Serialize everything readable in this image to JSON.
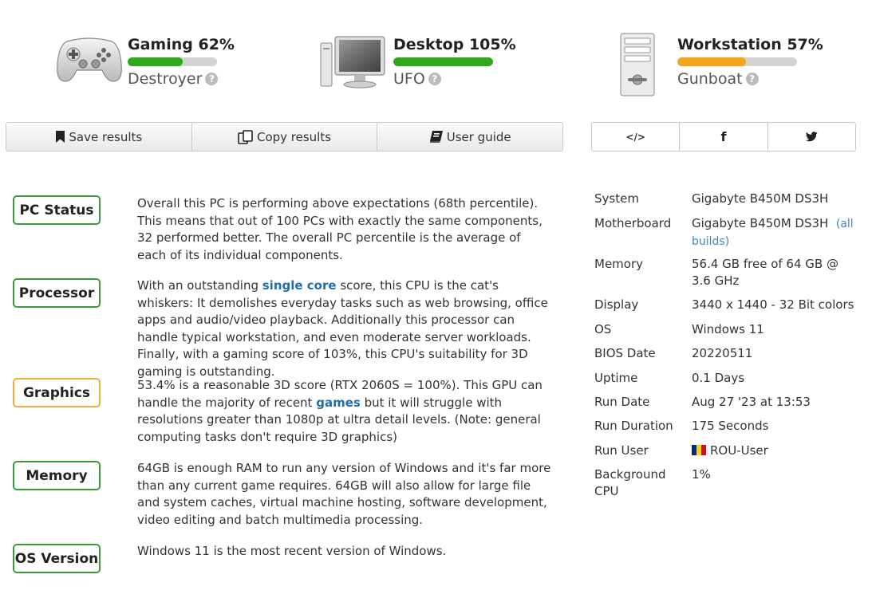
{
  "scores": [
    {
      "title": "Gaming 62%",
      "sub": "Destroyer",
      "percent": 62,
      "color": "#2fa81a",
      "icon": "gamepad-icon"
    },
    {
      "title": "Desktop 105%",
      "sub": "UFO",
      "percent": 100,
      "color": "#2fa81a",
      "icon": "desktop-monitor-icon"
    },
    {
      "title": "Workstation 57%",
      "sub": "Gunboat",
      "percent": 57,
      "color": "#f5a51d",
      "icon": "workstation-tower-icon"
    }
  ],
  "help_glyph": "?",
  "toolbar": {
    "save": "Save results",
    "copy": "Copy results",
    "guide": "User guide"
  },
  "share": {
    "embed": "</>",
    "facebook": "f"
  },
  "summary": [
    {
      "label": "PC Status",
      "status": "good",
      "text_before": "Overall this PC is performing above expectations (68th percentile). This means that out of 100 PCs with exactly the same components, 32 performed better. The overall PC percentile is the average of each of its individual components.",
      "link": "",
      "text_after": ""
    },
    {
      "label": "Processor",
      "status": "good",
      "text_before": "With an outstanding ",
      "link": "single core",
      "text_after": " score, this CPU is the cat's whiskers: It demolishes everyday tasks such as web browsing, office apps and audio/video playback. Additionally this processor can handle typical workstation, and even moderate server workloads. Finally, with a gaming score of 103%, this CPU's suitability for 3D gaming is outstanding."
    },
    {
      "label": "Graphics",
      "status": "warn",
      "text_before": "53.4% is a reasonable 3D score (RTX 2060S = 100%). This GPU can handle the majority of recent ",
      "link": "games",
      "text_after": " but it will struggle with resolutions greater than 1080p at ultra detail levels. (Note: general computing tasks don't require 3D graphics)"
    },
    {
      "label": "Memory",
      "status": "good",
      "text_before": "64GB is enough RAM to run any version of Windows and it's far more than any current game requires. 64GB will also allow for large file and system caches, virtual machine hosting, software development, video editing and batch multimedia processing.",
      "link": "",
      "text_after": ""
    },
    {
      "label": "OS Version",
      "status": "good",
      "text_before": "Windows 11 is the most recent version of Windows.",
      "link": "",
      "text_after": ""
    }
  ],
  "system": {
    "system_key": "System",
    "system_val": "Gigabyte B450M DS3H",
    "mb_key": "Motherboard",
    "mb_val": "Gigabyte B450M DS3H",
    "mb_link": "(all builds)",
    "mem_key": "Memory",
    "mem_val": "56.4 GB free of 64 GB @ 3.6 GHz",
    "display_key": "Display",
    "display_val": "3440 x 1440 - 32 Bit colors",
    "os_key": "OS",
    "os_val": "Windows 11",
    "bios_key": "BIOS Date",
    "bios_val": "20220511",
    "uptime_key": "Uptime",
    "uptime_val": "0.1 Days",
    "rundate_key": "Run Date",
    "rundate_val": "Aug 27 '23 at 13:53",
    "duration_key": "Run Duration",
    "duration_val": "175 Seconds",
    "user_key": "Run User",
    "user_val": "ROU-User",
    "bgcpu_key": "Background CPU",
    "bgcpu_val": "1%"
  }
}
